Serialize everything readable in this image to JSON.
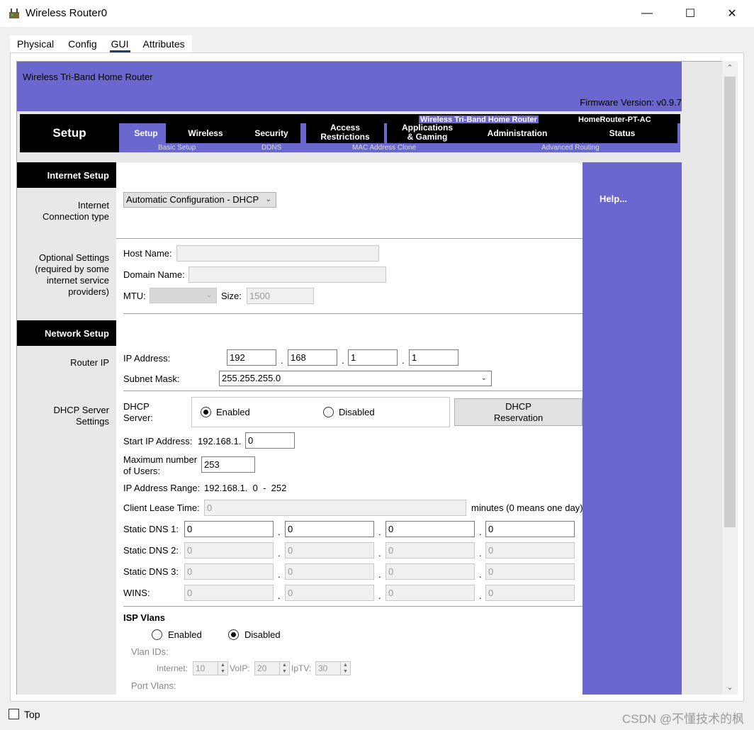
{
  "window": {
    "title": "Wireless Router0",
    "minimize": "—",
    "maximize": "☐",
    "close": "✕"
  },
  "tabs": [
    {
      "label": "Physical"
    },
    {
      "label": "Config"
    },
    {
      "label": "GUI",
      "active": true
    },
    {
      "label": "Attributes"
    }
  ],
  "router": {
    "brand": "Wireless Tri-Band Home Router",
    "firmware": "Firmware Version: v0.9.7",
    "nav_brand": "Wireless Tri-Band Home Router",
    "model": "HomeRouter-PT-AC",
    "section": "Setup",
    "nav": {
      "setup": "Setup",
      "wireless": "Wireless",
      "security": "Security",
      "access_1": "Access",
      "access_2": "Restrictions",
      "apps_1": "Applications",
      "apps_2": "& Gaming",
      "administration": "Administration",
      "status": "Status"
    },
    "subnav": {
      "basic_setup": "Basic Setup",
      "ddns": "DDNS",
      "mac_clone": "MAC Address Clone",
      "adv_routing": "Advanced Routing"
    },
    "help": "Help..."
  },
  "internet_setup": {
    "heading": "Internet Setup",
    "conn_type_label_1": "Internet",
    "conn_type_label_2": "Connection type",
    "conn_type_value": "Automatic Configuration - DHCP",
    "optional_1": "Optional Settings",
    "optional_2": "(required by some",
    "optional_3": "internet service",
    "optional_4": "providers)",
    "host_name_label": "Host Name:",
    "host_name": "",
    "domain_name_label": "Domain Name:",
    "domain_name": "",
    "mtu_label": "MTU:",
    "mtu_value": "",
    "size_label": "Size:",
    "size_value": "1500"
  },
  "network_setup": {
    "heading": "Network Setup",
    "router_ip_label": "Router IP",
    "ip_address_label": "IP Address:",
    "ip": [
      "192",
      "168",
      "1",
      "1"
    ],
    "subnet_label": "Subnet Mask:",
    "subnet_value": "255.255.255.0",
    "dhcp_label_1": "DHCP Server",
    "dhcp_label_2": "Settings",
    "dhcp_server_1": "DHCP",
    "dhcp_server_2": "Server:",
    "enabled": "Enabled",
    "disabled": "Disabled",
    "dhcp_enabled": true,
    "reservation_1": "DHCP",
    "reservation_2": "Reservation",
    "start_ip_label": "Start IP Address:",
    "start_ip_prefix": "192.168.1.",
    "start_ip_value": "0",
    "max_users_1": "Maximum number",
    "max_users_2": "of Users:",
    "max_users_value": "253",
    "ip_range_label": "IP Address Range:",
    "ip_range_value": "192.168.1.  0  -  252",
    "lease_label": "Client Lease Time:",
    "lease_value": "0",
    "lease_note": "minutes (0 means one day)",
    "dns1_label": "Static DNS 1:",
    "dns1": [
      "0",
      "0",
      "0",
      "0"
    ],
    "dns2_label": "Static DNS 2:",
    "dns2": [
      "0",
      "0",
      "0",
      "0"
    ],
    "dns3_label": "Static DNS 3:",
    "dns3": [
      "0",
      "0",
      "0",
      "0"
    ],
    "wins_label": "WINS:",
    "wins": [
      "0",
      "0",
      "0",
      "0"
    ]
  },
  "isp_vlans": {
    "heading": "ISP Vlans",
    "enabled": "Enabled",
    "disabled": "Disabled",
    "vlan_ids_label": "Vlan IDs:",
    "internet_label": "Internet:",
    "internet_value": "10",
    "voip_label": "VoIP:",
    "voip_value": "20",
    "iptv_label": "IpTV:",
    "iptv_value": "30",
    "port_vlans_label": "Port Vlans:"
  },
  "bottom": {
    "top_label": "Top",
    "watermark": "CSDN @不懂技术的枫"
  }
}
